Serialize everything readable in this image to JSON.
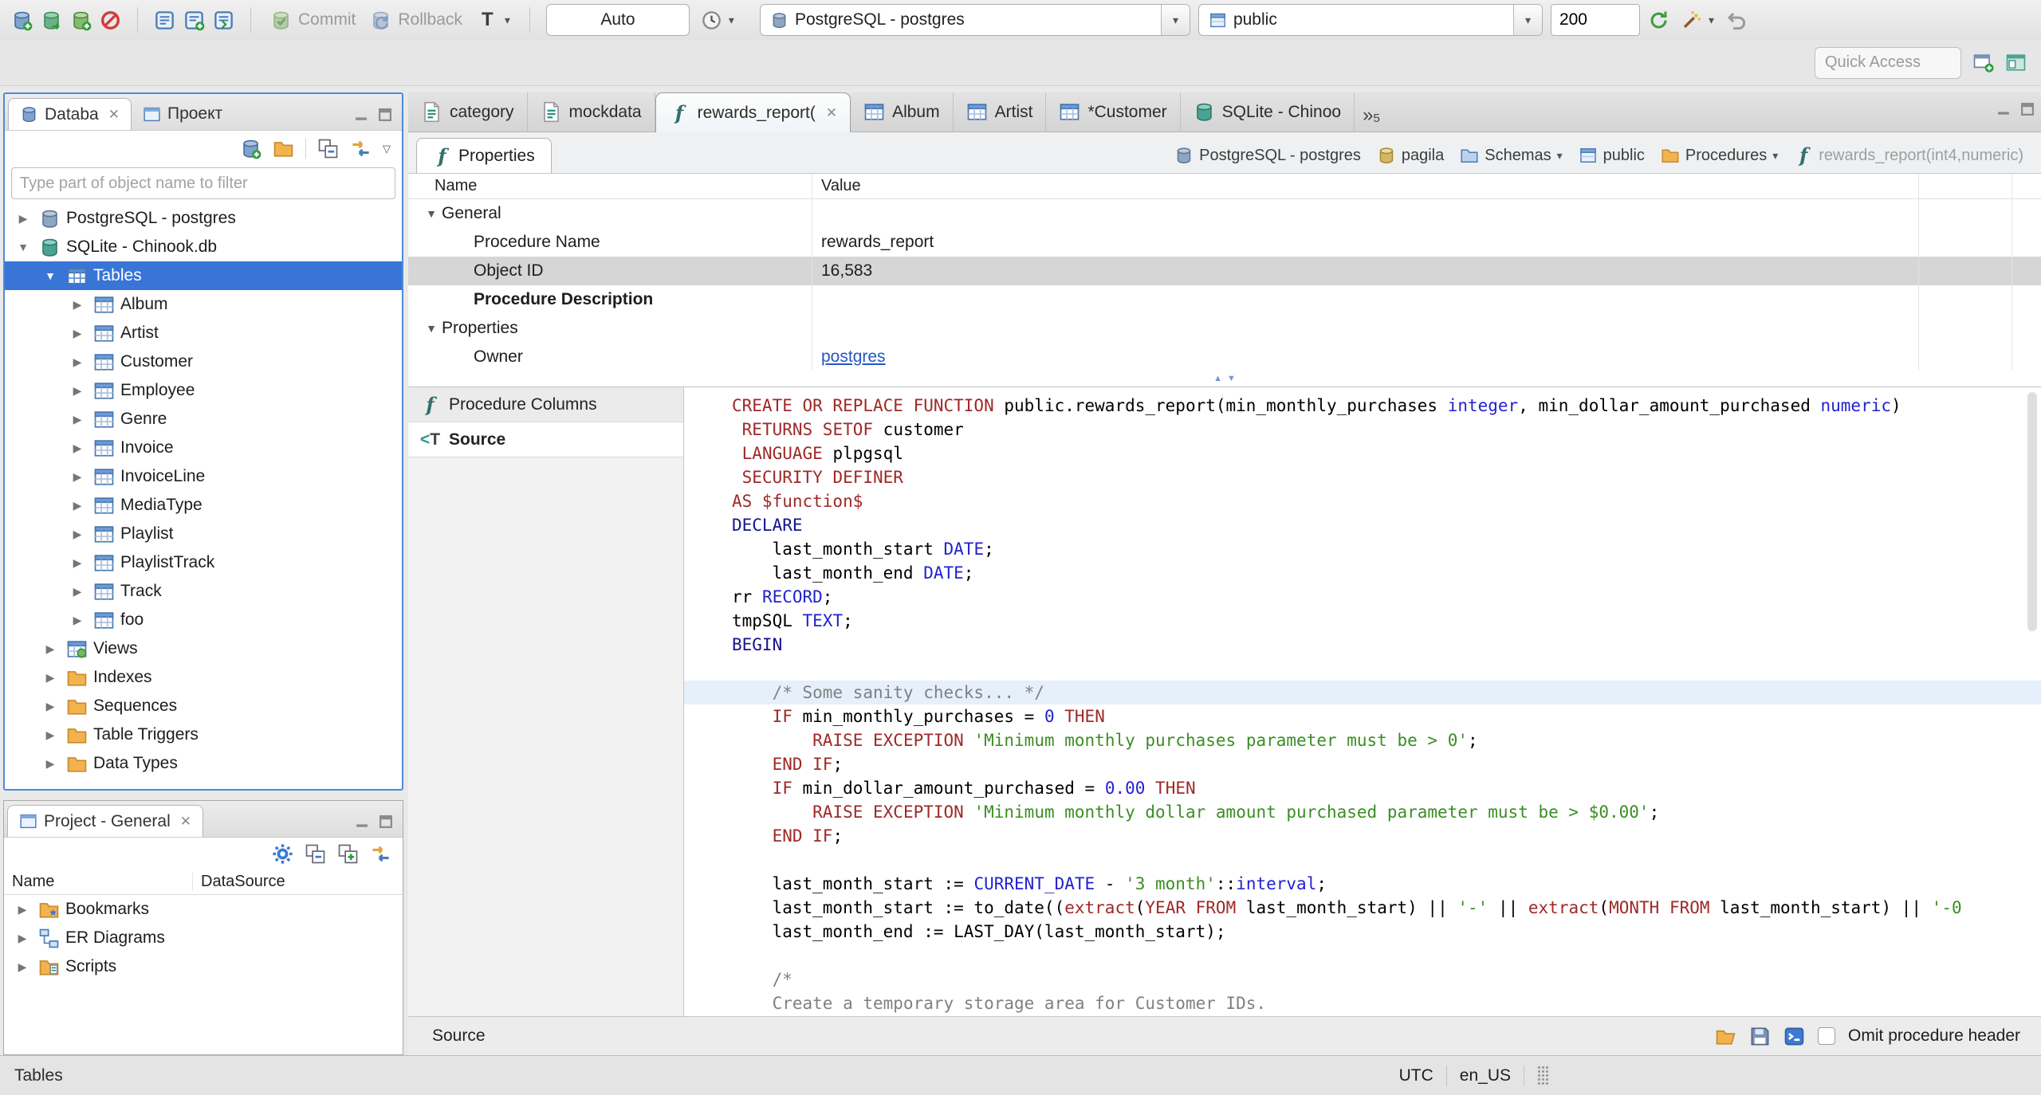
{
  "icons": {
    "close": "✕",
    "caret_down": "▾",
    "twistie_collapsed": "▶",
    "twistie_expanded": "▼",
    "chevron_overflow": "»",
    "collapser_up": "▲",
    "collapser_down": "▼"
  },
  "colors": {
    "selection": "#3875d7",
    "keyword": "#9e2927",
    "datatype": "#2222d0",
    "string": "#3a8e23",
    "comment": "#808080",
    "link": "#2456c4",
    "current_line": "#e6f0fb",
    "focus_border": "#4f8bd6"
  },
  "toolbar": {
    "commit_label": "Commit",
    "rollback_label": "Rollback",
    "auto_label": "Auto",
    "connection_combo": "PostgreSQL - postgres",
    "database_combo": "public",
    "fetch_size": "200",
    "quick_access_placeholder": "Quick Access"
  },
  "sidebar": {
    "tabs": [
      {
        "label": "Databa"
      },
      {
        "label": "Проект"
      }
    ],
    "filter_placeholder": "Type part of object name to filter",
    "tree": [
      {
        "label": "PostgreSQL - postgres",
        "icon": "postgres-db-icon",
        "depth": 0,
        "expanded": false
      },
      {
        "label": "SQLite - Chinook.db",
        "icon": "sqlite-db-icon",
        "depth": 0,
        "expanded": true
      },
      {
        "label": "Tables",
        "icon": "tables-folder-icon",
        "depth": 1,
        "expanded": true,
        "selected": true
      },
      {
        "label": "Album",
        "icon": "table-icon",
        "depth": 2,
        "expanded": false
      },
      {
        "label": "Artist",
        "icon": "table-icon",
        "depth": 2,
        "expanded": false
      },
      {
        "label": "Customer",
        "icon": "table-icon",
        "depth": 2,
        "expanded": false
      },
      {
        "label": "Employee",
        "icon": "table-icon",
        "depth": 2,
        "expanded": false
      },
      {
        "label": "Genre",
        "icon": "table-icon",
        "depth": 2,
        "expanded": false
      },
      {
        "label": "Invoice",
        "icon": "table-icon",
        "depth": 2,
        "expanded": false
      },
      {
        "label": "InvoiceLine",
        "icon": "table-icon",
        "depth": 2,
        "expanded": false
      },
      {
        "label": "MediaType",
        "icon": "table-icon",
        "depth": 2,
        "expanded": false
      },
      {
        "label": "Playlist",
        "icon": "table-icon",
        "depth": 2,
        "expanded": false
      },
      {
        "label": "PlaylistTrack",
        "icon": "table-icon",
        "depth": 2,
        "expanded": false
      },
      {
        "label": "Track",
        "icon": "table-icon",
        "depth": 2,
        "expanded": false
      },
      {
        "label": "foo",
        "icon": "table-icon",
        "depth": 2,
        "expanded": false
      },
      {
        "label": "Views",
        "icon": "views-icon",
        "depth": 1,
        "expanded": false
      },
      {
        "label": "Indexes",
        "icon": "folder-icon",
        "depth": 1,
        "expanded": false
      },
      {
        "label": "Sequences",
        "icon": "folder-icon",
        "depth": 1,
        "expanded": false
      },
      {
        "label": "Table Triggers",
        "icon": "folder-icon",
        "depth": 1,
        "expanded": false
      },
      {
        "label": "Data Types",
        "icon": "folder-icon",
        "depth": 1,
        "expanded": false
      }
    ]
  },
  "project_panel": {
    "tab_label": "Project - General",
    "columns": [
      "Name",
      "DataSource"
    ],
    "rows": [
      {
        "label": "Bookmarks",
        "icon": "bookmarks-icon"
      },
      {
        "label": "ER Diagrams",
        "icon": "er-diagram-icon"
      },
      {
        "label": "Scripts",
        "icon": "scripts-icon"
      }
    ]
  },
  "editor": {
    "tabs": [
      {
        "label": "category",
        "icon": "sql-script-icon"
      },
      {
        "label": "mockdata",
        "icon": "sql-script-icon"
      },
      {
        "label": "rewards_report(",
        "icon": "function-icon",
        "active": true,
        "closable": true
      },
      {
        "label": "Album",
        "icon": "table-icon"
      },
      {
        "label": "Artist",
        "icon": "table-icon"
      },
      {
        "label": "*Customer",
        "icon": "table-icon"
      },
      {
        "label": "SQLite - Chinoo",
        "icon": "sqlite-db-icon"
      }
    ],
    "tab_overflow_count": "5",
    "properties_tab": "Properties",
    "breadcrumb": [
      {
        "label": "PostgreSQL - postgres",
        "icon": "postgres-db-icon"
      },
      {
        "label": "pagila",
        "icon": "db-icon"
      },
      {
        "label": "Schemas",
        "icon": "schemas-folder-icon",
        "dropdown": true
      },
      {
        "label": "public",
        "icon": "schema-icon"
      },
      {
        "label": "Procedures",
        "icon": "folder-icon",
        "dropdown": true
      },
      {
        "label": "rewards_report(int4,numeric)",
        "icon": "function-icon",
        "muted": true
      }
    ],
    "grid": {
      "columns": [
        "Name",
        "Value"
      ],
      "rows": [
        {
          "kind": "group",
          "name": "General"
        },
        {
          "kind": "prop",
          "name": "Procedure Name",
          "value": "rewards_report"
        },
        {
          "kind": "prop",
          "name": "Object ID",
          "value": "16,583",
          "selected": true
        },
        {
          "kind": "prop",
          "name": "Procedure Description",
          "value": "",
          "bold": true
        },
        {
          "kind": "group",
          "name": "Properties"
        },
        {
          "kind": "prop",
          "name": "Owner",
          "value": "postgres",
          "link": true
        }
      ]
    },
    "subtabs": [
      {
        "label": "Procedure Columns",
        "icon": "function-icon"
      },
      {
        "label": "Source",
        "icon": "source-icon",
        "active": true
      }
    ],
    "status_label": "Source",
    "omit_checkbox_label": "Omit procedure header"
  },
  "statusbar": {
    "left": "Tables",
    "timezone": "UTC",
    "locale": "en_US"
  },
  "code": {
    "lines": [
      {
        "seg": [
          [
            "k",
            "CREATE OR REPLACE FUNCTION"
          ],
          [
            "p",
            " public.rewards_report(min_monthly_purchases "
          ],
          [
            "t",
            "integer"
          ],
          [
            "p",
            ", min_dollar_amount_purchased "
          ],
          [
            "t",
            "numeric"
          ],
          [
            "p",
            ")"
          ]
        ]
      },
      {
        "seg": [
          [
            "p",
            " "
          ],
          [
            "k",
            "RETURNS SETOF"
          ],
          [
            "p",
            " customer"
          ]
        ]
      },
      {
        "seg": [
          [
            "p",
            " "
          ],
          [
            "k",
            "LANGUAGE"
          ],
          [
            "p",
            " plpgsql"
          ]
        ]
      },
      {
        "seg": [
          [
            "p",
            " "
          ],
          [
            "k",
            "SECURITY DEFINER"
          ]
        ]
      },
      {
        "seg": [
          [
            "k",
            "AS $function$"
          ]
        ]
      },
      {
        "seg": [
          [
            "b",
            "DECLARE"
          ]
        ]
      },
      {
        "seg": [
          [
            "p",
            "    last_month_start "
          ],
          [
            "t",
            "DATE"
          ],
          [
            "p",
            ";"
          ]
        ]
      },
      {
        "seg": [
          [
            "p",
            "    last_month_end "
          ],
          [
            "t",
            "DATE"
          ],
          [
            "p",
            ";"
          ]
        ]
      },
      {
        "seg": [
          [
            "p",
            "rr "
          ],
          [
            "t",
            "RECORD"
          ],
          [
            "p",
            ";"
          ]
        ]
      },
      {
        "seg": [
          [
            "p",
            "tmpSQL "
          ],
          [
            "t",
            "TEXT"
          ],
          [
            "p",
            ";"
          ]
        ]
      },
      {
        "seg": [
          [
            "b",
            "BEGIN"
          ]
        ]
      },
      {
        "seg": []
      },
      {
        "hl": true,
        "seg": [
          [
            "c",
            "    /* Some sanity checks... */"
          ]
        ]
      },
      {
        "seg": [
          [
            "p",
            "    "
          ],
          [
            "k",
            "IF"
          ],
          [
            "p",
            " min_monthly_purchases = "
          ],
          [
            "n",
            "0"
          ],
          [
            "p",
            " "
          ],
          [
            "k",
            "THEN"
          ]
        ]
      },
      {
        "seg": [
          [
            "p",
            "        "
          ],
          [
            "k",
            "RAISE EXCEPTION"
          ],
          [
            "p",
            " "
          ],
          [
            "s",
            "'Minimum monthly purchases parameter must be > 0'"
          ],
          [
            "p",
            ";"
          ]
        ]
      },
      {
        "seg": [
          [
            "p",
            "    "
          ],
          [
            "k",
            "END IF"
          ],
          [
            "p",
            ";"
          ]
        ]
      },
      {
        "seg": [
          [
            "p",
            "    "
          ],
          [
            "k",
            "IF"
          ],
          [
            "p",
            " min_dollar_amount_purchased = "
          ],
          [
            "n",
            "0.00"
          ],
          [
            "p",
            " "
          ],
          [
            "k",
            "THEN"
          ]
        ]
      },
      {
        "seg": [
          [
            "p",
            "        "
          ],
          [
            "k",
            "RAISE EXCEPTION"
          ],
          [
            "p",
            " "
          ],
          [
            "s",
            "'Minimum monthly dollar amount purchased parameter must be > $0.00'"
          ],
          [
            "p",
            ";"
          ]
        ]
      },
      {
        "seg": [
          [
            "p",
            "    "
          ],
          [
            "k",
            "END IF"
          ],
          [
            "p",
            ";"
          ]
        ]
      },
      {
        "seg": []
      },
      {
        "seg": [
          [
            "p",
            "    last_month_start := "
          ],
          [
            "t",
            "CURRENT_DATE"
          ],
          [
            "p",
            " - "
          ],
          [
            "s",
            "'3 month'"
          ],
          [
            "p",
            "::"
          ],
          [
            "t",
            "interval"
          ],
          [
            "p",
            ";"
          ]
        ]
      },
      {
        "seg": [
          [
            "p",
            "    last_month_start := to_date(("
          ],
          [
            "k",
            "extract"
          ],
          [
            "p",
            "("
          ],
          [
            "k",
            "YEAR"
          ],
          [
            "p",
            " "
          ],
          [
            "k",
            "FROM"
          ],
          [
            "p",
            " last_month_start) || "
          ],
          [
            "s",
            "'-'"
          ],
          [
            "p",
            " || "
          ],
          [
            "k",
            "extract"
          ],
          [
            "p",
            "("
          ],
          [
            "k",
            "MONTH"
          ],
          [
            "p",
            " "
          ],
          [
            "k",
            "FROM"
          ],
          [
            "p",
            " last_month_start) || "
          ],
          [
            "s",
            "'-0"
          ]
        ]
      },
      {
        "seg": [
          [
            "p",
            "    last_month_end := LAST_DAY(last_month_start);"
          ]
        ]
      },
      {
        "seg": []
      },
      {
        "seg": [
          [
            "c",
            "    /*"
          ]
        ]
      },
      {
        "seg": [
          [
            "c",
            "    Create a temporary storage area for Customer IDs."
          ]
        ]
      },
      {
        "seg": [
          [
            "c",
            "    */"
          ]
        ]
      }
    ]
  }
}
